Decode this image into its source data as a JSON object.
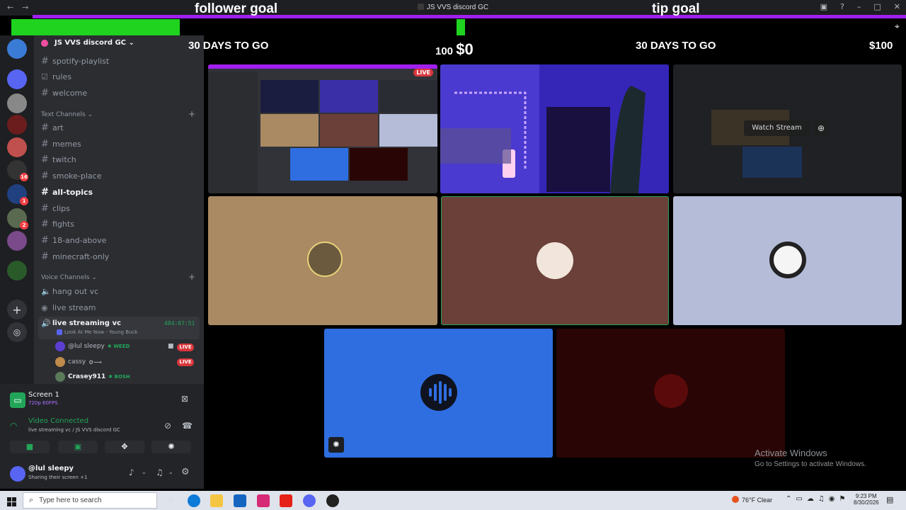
{
  "window": {
    "title": "JS VVS discord GC",
    "nav_back": "←",
    "nav_forward": "→"
  },
  "overlay": {
    "follower_goal": {
      "label": "follower goal",
      "days_left": "30 DAYS TO GO",
      "current": "100",
      "fill_fraction": 0.19
    },
    "tip_goal": {
      "label": "tip goal",
      "current": "$0",
      "days_left": "30 DAYS TO GO",
      "target": "$100"
    }
  },
  "server": {
    "name": "JS VVS discord GC"
  },
  "channels_top": [
    {
      "name": "spotify-playlist",
      "icon": "hash-icon"
    },
    {
      "name": "rules",
      "icon": "rules-icon"
    },
    {
      "name": "welcome",
      "icon": "hash-icon"
    }
  ],
  "text_category": "Text Channels",
  "text_channels": [
    {
      "name": "art",
      "active": false
    },
    {
      "name": "memes",
      "active": false
    },
    {
      "name": "twitch",
      "active": false
    },
    {
      "name": "smoke-place",
      "active": false
    },
    {
      "name": "all-topics",
      "active": true
    },
    {
      "name": "clips",
      "active": false
    },
    {
      "name": "fights",
      "active": false
    },
    {
      "name": "18-and-above",
      "active": false
    },
    {
      "name": "minecraft-only",
      "active": false
    }
  ],
  "voice_category": "Voice Channels",
  "voice_channels": [
    {
      "name": "hang out vc"
    },
    {
      "name": "live stream"
    }
  ],
  "active_voice": {
    "name": "live streaming vc",
    "timer": "484:07:51",
    "activity": "Look At Me Now - Young Buck",
    "users": [
      {
        "name": "@lul sleepy",
        "tag": "WEED",
        "live": "LIVE",
        "color": "#5b3fd0"
      },
      {
        "name": "cassy",
        "tag": "",
        "live": "LIVE",
        "color": "#c08a4a"
      },
      {
        "name": "Crasey911",
        "tag": "BOSH",
        "live": "",
        "color": "#5a7a5a"
      }
    ]
  },
  "screen_share": {
    "title": "Screen 1",
    "quality": "720p 60FPS"
  },
  "connection": {
    "status": "Video Connected",
    "location": "live streaming vc / JS VVS discord GC"
  },
  "user": {
    "name": "@lul sleepy",
    "status": "Sharing their screen +1"
  },
  "tiles": {
    "live_label": "LIVE",
    "watch_label": "Watch Stream"
  },
  "activate_windows": {
    "title": "Activate Windows",
    "subtitle": "Go to Settings to activate Windows."
  },
  "taskbar": {
    "search_placeholder": "Type here to search",
    "weather": "76°F  Clear",
    "time": "9:23 PM",
    "date": "8/30/2026"
  },
  "servers": [
    {
      "color": "#3a7bd5",
      "badge": ""
    },
    {
      "color": "#5865f2",
      "badge": ""
    },
    {
      "color": "#888888",
      "badge": ""
    },
    {
      "color": "#6b1d1d",
      "badge": ""
    },
    {
      "color": "#c0504d",
      "badge": ""
    },
    {
      "color": "#333333",
      "badge": "16"
    },
    {
      "color": "#204080",
      "badge": "1"
    },
    {
      "color": "#5a6a50",
      "badge": "2"
    },
    {
      "color": "#7a4a8a",
      "badge": ""
    },
    {
      "color": "#2a5a2a",
      "badge": ""
    }
  ]
}
